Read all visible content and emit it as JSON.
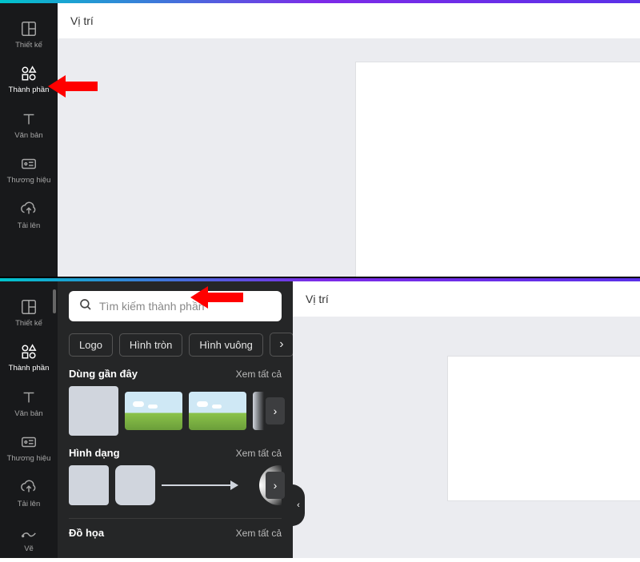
{
  "top": {
    "toolbar": {
      "position_label": "Vị trí"
    },
    "sidebar": [
      {
        "key": "design",
        "label": "Thiết kế"
      },
      {
        "key": "elements",
        "label": "Thành phần"
      },
      {
        "key": "text",
        "label": "Văn bản"
      },
      {
        "key": "brand",
        "label": "Thương hiệu"
      },
      {
        "key": "upload",
        "label": "Tải lên"
      }
    ]
  },
  "bottom": {
    "toolbar": {
      "position_label": "Vị trí"
    },
    "sidebar": [
      {
        "key": "design",
        "label": "Thiết kế"
      },
      {
        "key": "elements",
        "label": "Thành phần"
      },
      {
        "key": "text",
        "label": "Văn bản"
      },
      {
        "key": "brand",
        "label": "Thương hiệu"
      },
      {
        "key": "upload",
        "label": "Tải lên"
      },
      {
        "key": "draw",
        "label": "Vẽ"
      }
    ],
    "panel": {
      "search_placeholder": "Tìm kiếm thành phần",
      "chips": [
        "Logo",
        "Hình tròn",
        "Hình vuông"
      ],
      "sections": {
        "recent": {
          "title": "Dùng gần đây",
          "see_all": "Xem tất cả"
        },
        "shapes": {
          "title": "Hình dạng",
          "see_all": "Xem tất cả"
        },
        "graphics": {
          "title": "Đồ họa",
          "see_all": "Xem tất cả"
        }
      }
    }
  }
}
